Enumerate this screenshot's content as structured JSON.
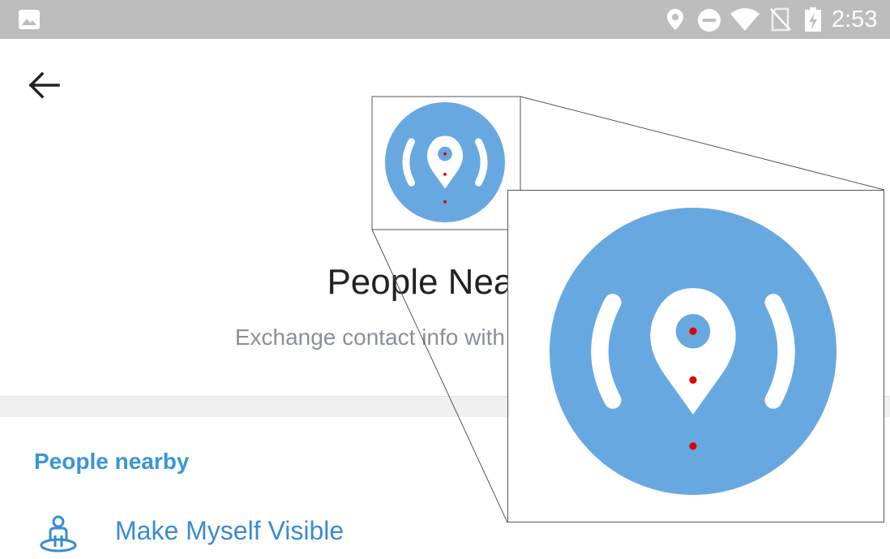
{
  "status_bar": {
    "time": "2:53",
    "icons": [
      "gallery-icon",
      "location-icon",
      "do-not-disturb-icon",
      "wifi-icon",
      "no-sim-icon",
      "battery-charging-icon"
    ]
  },
  "header": {
    "back_icon": "arrow-left-icon",
    "hero_icon": "people-nearby-icon",
    "title": "People Nearby",
    "subtitle": "Exchange contact info with people nearby"
  },
  "section": {
    "header": "People nearby",
    "items": [
      {
        "icon": "make-visible-icon",
        "label": "Make Myself Visible"
      }
    ]
  },
  "colors": {
    "accent": "#3a95d5",
    "icon_blue": "#68a8e0",
    "status_bar": "#bdbdbd",
    "subtitle": "#8a9097",
    "marker": "#e00000"
  }
}
